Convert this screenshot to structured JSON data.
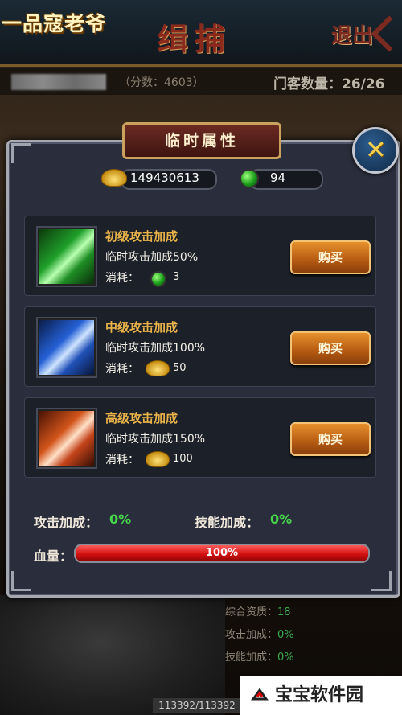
{
  "header": {
    "logo": "一品寇老爷",
    "title": "缉捕",
    "exit_label": "退出"
  },
  "info": {
    "score": "（分数：4603）",
    "member_count": "门客数量：26/26"
  },
  "dialog": {
    "title": "临时属性",
    "gold_amount": "149430613",
    "jade_amount": "94",
    "items": [
      {
        "name": "初级攻击加成",
        "desc": "临时攻击加成50%",
        "cost_label": "消耗：",
        "cost_icon": "jade-icon",
        "cost_value": "3",
        "buy_label": "购买",
        "color": "green"
      },
      {
        "name": "中级攻击加成",
        "desc": "临时攻击加成100%",
        "cost_label": "消耗：",
        "cost_icon": "gold-ingot-icon",
        "cost_value": "50",
        "buy_label": "购买",
        "color": "blue"
      },
      {
        "name": "高级攻击加成",
        "desc": "临时攻击加成150%",
        "cost_label": "消耗：",
        "cost_icon": "gold-ingot-icon",
        "cost_value": "100",
        "buy_label": "购买",
        "color": "orange"
      }
    ],
    "attack_bonus_label": "攻击加成：",
    "attack_bonus_value": "0%",
    "skill_bonus_label": "技能加成：",
    "skill_bonus_value": "0%",
    "hp_label": "血量：",
    "hp_value": "100%",
    "hp_fraction": 1.0
  },
  "background_stats": {
    "aptitude_label": "综合资质：",
    "aptitude_value": "18",
    "attack_label": "攻击加成：",
    "attack_value": "0%",
    "skill_label": "技能加成：",
    "skill_value": "0%",
    "hp_text": "113392/113392"
  },
  "watermark": "宝宝软件园",
  "colors": {
    "bonus_green": "#45d64a",
    "item_name_gold": "#e9b34a",
    "button_orange": "#d3791f",
    "hp_red": "#d31010"
  }
}
